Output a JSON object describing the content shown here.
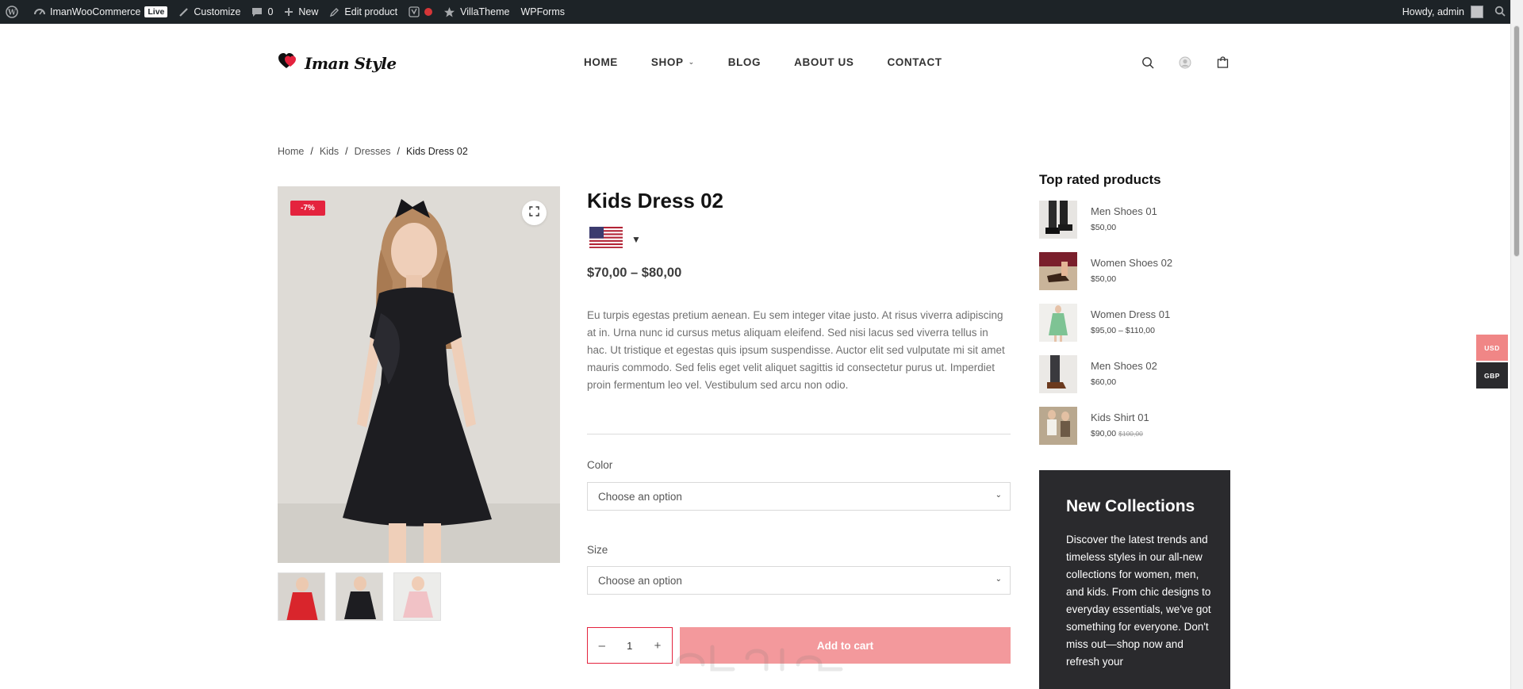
{
  "admin_bar": {
    "site_name": "ImanWooCommerce",
    "live_label": "Live",
    "customize": "Customize",
    "comments_count": "0",
    "new_label": "New",
    "edit_product": "Edit product",
    "villatheme": "VillaTheme",
    "wpforms": "WPForms",
    "greeting": "Howdy, admin"
  },
  "site": {
    "logo_text": "Iman Style",
    "nav": [
      {
        "label": "HOME"
      },
      {
        "label": "SHOP",
        "has_dropdown": true
      },
      {
        "label": "BLOG"
      },
      {
        "label": "ABOUT US"
      },
      {
        "label": "CONTACT"
      }
    ]
  },
  "breadcrumb": {
    "items": [
      "Home",
      "Kids",
      "Dresses"
    ],
    "separator": "/",
    "current": "Kids Dress 02"
  },
  "product": {
    "sale_badge": "-7%",
    "title": "Kids Dress 02",
    "price": "$70,00 – $80,00",
    "description": "Eu turpis egestas pretium aenean. Eu sem integer vitae justo. At risus viverra adipiscing at in. Urna nunc id cursus metus aliquam eleifend. Sed nisi lacus sed viverra tellus in hac. Ut tristique et egestas quis ipsum suspendisse. Auctor elit sed vulputate mi sit amet mauris commodo. Sed felis eget velit aliquet sagittis id consectetur purus ut. Imperdiet proin fermentum leo vel. Vestibulum sed arcu non odio.",
    "color_label": "Color",
    "color_placeholder": "Choose an option",
    "size_label": "Size",
    "size_placeholder": "Choose an option",
    "quantity": "1",
    "qty_minus": "–",
    "qty_plus": "+",
    "add_to_cart": "Add to cart",
    "thumbnails": [
      "red-dress",
      "black-dress",
      "pink-dress"
    ]
  },
  "sidebar": {
    "top_rated_title": "Top rated products",
    "top_rated": [
      {
        "name": "Men Shoes 01",
        "price": "$50,00",
        "old_price": ""
      },
      {
        "name": "Women Shoes 02",
        "price": "$50,00",
        "old_price": ""
      },
      {
        "name": "Women Dress 01",
        "price": "$95,00 – $110,00",
        "old_price": ""
      },
      {
        "name": "Men Shoes 02",
        "price": "$60,00",
        "old_price": ""
      },
      {
        "name": "Kids Shirt 01",
        "price": "$90,00",
        "old_price": "$100,00"
      }
    ],
    "promo_title": "New Collections",
    "promo_text": "Discover the latest trends and timeless styles in our all-new collections for women, men, and kids. From chic designs to everyday essentials, we've got something for everyone. Don't miss out—shop now and refresh your"
  },
  "currency_switcher": [
    {
      "code": "USD",
      "color": "#f08686"
    },
    {
      "code": "GBP",
      "color": "#2a2a2d"
    }
  ],
  "colors": {
    "accent": "#e4233e",
    "add_to_cart_bg": "#f3999c",
    "admin_bar_bg": "#1d2327",
    "promo_bg": "#2a2a2d"
  }
}
